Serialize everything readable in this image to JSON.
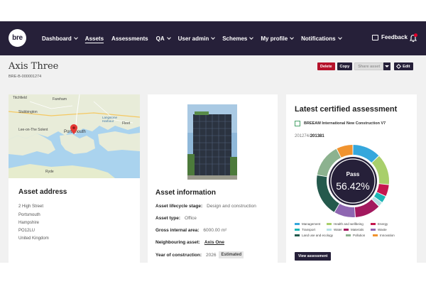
{
  "nav": {
    "logo": "bre",
    "items": [
      {
        "label": "Dashboard",
        "dropdown": true,
        "active": false
      },
      {
        "label": "Assets",
        "dropdown": false,
        "active": true
      },
      {
        "label": "Assessments",
        "dropdown": false,
        "active": false
      },
      {
        "label": "QA",
        "dropdown": true,
        "active": false
      },
      {
        "label": "User admin",
        "dropdown": true,
        "active": false
      },
      {
        "label": "Schemes",
        "dropdown": true,
        "active": false
      },
      {
        "label": "My profile",
        "dropdown": true,
        "active": false
      },
      {
        "label": "Notifications",
        "dropdown": true,
        "active": false
      }
    ],
    "feedback": "Feedback"
  },
  "page": {
    "title": "Axis Three",
    "id": "BRE-B-000001274"
  },
  "actions": {
    "delete": "Delete",
    "copy": "Copy",
    "share": "Share asset",
    "edit": "Edit"
  },
  "map": {
    "labels": [
      {
        "text": "Titchfield"
      },
      {
        "text": "Fareham"
      },
      {
        "text": "Stubbington"
      },
      {
        "text": "Langstone Harbour"
      },
      {
        "text": "Fleet"
      },
      {
        "text": "Lee-on-The Solent"
      },
      {
        "text": "Portsmouth"
      },
      {
        "text": "Ryde"
      }
    ]
  },
  "address": {
    "heading": "Asset address",
    "lines": [
      "2 High Street",
      "Portsmouth",
      "Hampshire",
      "PO12LU",
      "United Kingdom"
    ]
  },
  "info": {
    "heading": "Asset information",
    "rows": [
      {
        "label": "Asset lifecycle stage:",
        "value": "Design and construction"
      },
      {
        "label": "Asset type:",
        "value": "Office"
      },
      {
        "label": "Gross internal area:",
        "value": "6000.00 m²"
      },
      {
        "label": "Neighbouring asset:",
        "value": "Axis One"
      },
      {
        "label": "Year of construction:",
        "value": "2026",
        "badge": "Estimated"
      }
    ]
  },
  "assessment": {
    "heading": "Latest certified assessment",
    "scheme": "BREEAM International New Construction V7",
    "ref_prefix": "201274/",
    "ref_suffix": "201381",
    "rating": "Pass",
    "score": "56.42%",
    "view_button": "View assessment"
  },
  "chart_data": {
    "type": "pie",
    "center_label": "Pass",
    "center_value": "56.42%",
    "series": [
      {
        "name": "Management",
        "color": "#35a7dc",
        "value": 12
      },
      {
        "name": "Health and wellbeing",
        "color": "#a8cf6b",
        "value": 13
      },
      {
        "name": "Energy",
        "color": "#c5174f",
        "value": 5
      },
      {
        "name": "Transport",
        "color": "#1bb5b5",
        "value": 3
      },
      {
        "name": "Water",
        "color": "#b5dfe4",
        "value": 2
      },
      {
        "name": "Materials",
        "color": "#a2185e",
        "value": 11
      },
      {
        "name": "Waste",
        "color": "#8e66b1",
        "value": 9
      },
      {
        "name": "Land use and ecology",
        "color": "#24594c",
        "value": 18
      },
      {
        "name": "Pollution",
        "color": "#8cb28f",
        "value": 14
      },
      {
        "name": "Innovation",
        "color": "#f0932f",
        "value": 7
      }
    ],
    "gap_color": "#e0e0e0"
  }
}
